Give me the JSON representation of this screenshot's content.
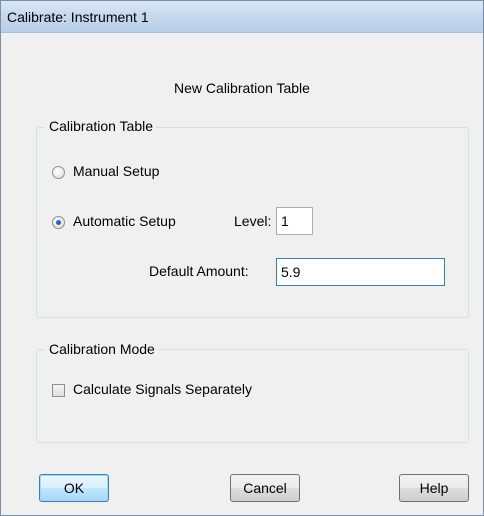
{
  "window": {
    "title": "Calibrate: Instrument 1"
  },
  "heading": "New Calibration Table",
  "calibration_table": {
    "legend": "Calibration Table",
    "manual_setup": {
      "label": "Manual Setup",
      "checked": false
    },
    "automatic_setup": {
      "label": "Automatic Setup",
      "checked": true
    },
    "level": {
      "label": "Level:",
      "value": "1"
    },
    "default_amount": {
      "label": "Default Amount:",
      "value": "5.9"
    }
  },
  "calibration_mode": {
    "legend": "Calibration Mode",
    "calculate_signals_separately": {
      "label": "Calculate Signals Separately",
      "checked": false
    }
  },
  "buttons": {
    "ok": "OK",
    "cancel": "Cancel",
    "help": "Help"
  }
}
